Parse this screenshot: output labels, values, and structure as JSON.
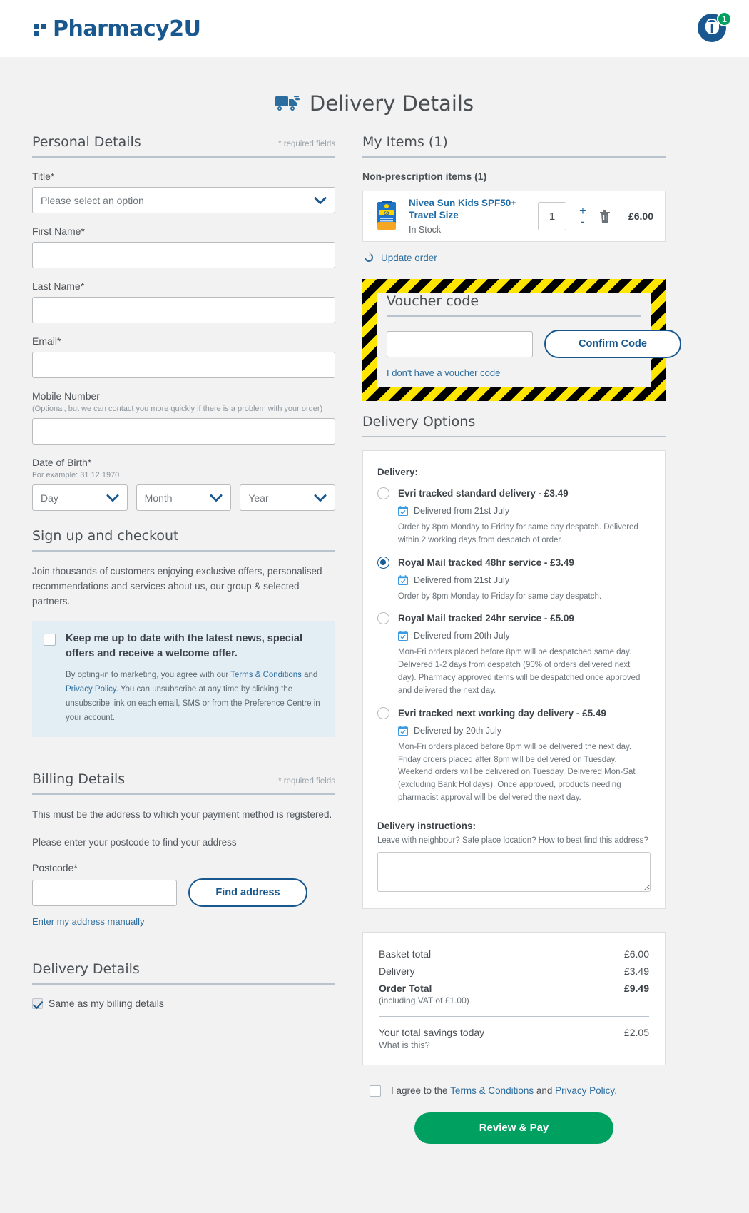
{
  "header": {
    "brand": "Pharmacy2U",
    "cart_count": "1"
  },
  "title": "Delivery Details",
  "personal": {
    "heading": "Personal Details",
    "required_note": "* required fields",
    "title_label": "Title*",
    "title_value": "Please select an option",
    "first_name_label": "First Name*",
    "first_name_value": "",
    "last_name_label": "Last Name*",
    "last_name_value": "",
    "email_label": "Email*",
    "email_value": "",
    "mobile_label": "Mobile Number",
    "mobile_hint": "(Optional, but we can contact you more quickly if there is a problem with your order)",
    "mobile_value": "",
    "dob_label": "Date of Birth*",
    "dob_hint": "For example: 31 12 1970",
    "dob_day": "Day",
    "dob_month": "Month",
    "dob_year": "Year"
  },
  "signup": {
    "heading": "Sign up and checkout",
    "intro": "Join thousands of customers enjoying exclusive offers, personalised recommendations and services about us, our group & selected partners.",
    "marketing_title": "Keep me up to date with the latest news, special offers and receive a welcome offer.",
    "legal_1": "By opting-in to marketing, you agree with our ",
    "terms_link": "Terms & Conditions",
    "legal_2": " and ",
    "privacy_link": "Privacy Policy",
    "legal_3": ". You can unsubscribe at any time by clicking the unsubscribe link on each email, SMS or from the Preference Centre in your account."
  },
  "billing": {
    "heading": "Billing Details",
    "required_note": "* required fields",
    "note": "This must be the address to which your payment method is registered.",
    "instruction": "Please enter your postcode to find your address",
    "postcode_label": "Postcode*",
    "postcode_value": "",
    "find_address_label": "Find address",
    "manual_link": "Enter my address manually"
  },
  "delivery_details": {
    "heading": "Delivery Details",
    "same_as_billing": "Same as my billing details"
  },
  "items": {
    "heading": "My Items (1)",
    "subheading": "Non-prescription items (1)",
    "rows": [
      {
        "name": "Nivea Sun Kids SPF50+ Travel Size",
        "stock": "In Stock",
        "qty": "1",
        "plus": "+",
        "minus": "-",
        "price": "£6.00"
      }
    ],
    "update_order": "Update order"
  },
  "voucher": {
    "heading": "Voucher code",
    "input_value": "",
    "confirm_label": "Confirm Code",
    "no_voucher_link": "I don't have a voucher code"
  },
  "delivery_options": {
    "heading": "Delivery Options",
    "group_label": "Delivery:",
    "options": [
      {
        "title": "Evri tracked standard delivery - £3.49",
        "date": "Delivered from 21st July",
        "desc": "Order by 8pm Monday to Friday for same day despatch. Delivered within 2 working days from despatch of order.",
        "selected": false
      },
      {
        "title": "Royal Mail tracked 48hr service - £3.49",
        "date": "Delivered from 21st July",
        "desc": "Order by 8pm Monday to Friday for same day despatch.",
        "selected": true
      },
      {
        "title": "Royal Mail tracked 24hr service - £5.09",
        "date": "Delivered from 20th July",
        "desc": "Mon-Fri orders placed before 8pm will be despatched same day. Delivered 1-2 days from despatch (90% of orders delivered next day). Pharmacy approved items will be despatched once approved and delivered the next day.",
        "selected": false
      },
      {
        "title": "Evri tracked next working day delivery - £5.49",
        "date": "Delivered by 20th July",
        "desc": "Mon-Fri orders placed before 8pm will be delivered the next day. Friday orders placed after 8pm will be delivered on Tuesday. Weekend orders will be delivered on Tuesday. Delivered Mon-Sat (excluding Bank Holidays). Once approved, products needing pharmacist approval will be delivered the next day.",
        "selected": false
      }
    ],
    "instructions_label": "Delivery instructions:",
    "instructions_hint": "Leave with neighbour? Safe place location? How to best find this address?",
    "instructions_value": ""
  },
  "totals": {
    "basket_label": "Basket total",
    "basket_value": "£6.00",
    "delivery_label": "Delivery",
    "delivery_value": "£3.49",
    "order_total_label": "Order Total",
    "order_total_value": "£9.49",
    "vat_note": "(including VAT of £1.00)",
    "savings_label": "Your total savings today",
    "savings_value": "£2.05",
    "what_is_this": "What is this?"
  },
  "footer": {
    "agree_1": "I agree to the ",
    "terms_link": "Terms & Conditions",
    "agree_2": " and ",
    "privacy_link": "Privacy Policy",
    "agree_3": ".",
    "pay_button": "Review & Pay"
  },
  "colors": {
    "brand_blue": "#18588e",
    "green": "#00a160",
    "hazard_yellow": "#ffe600"
  }
}
